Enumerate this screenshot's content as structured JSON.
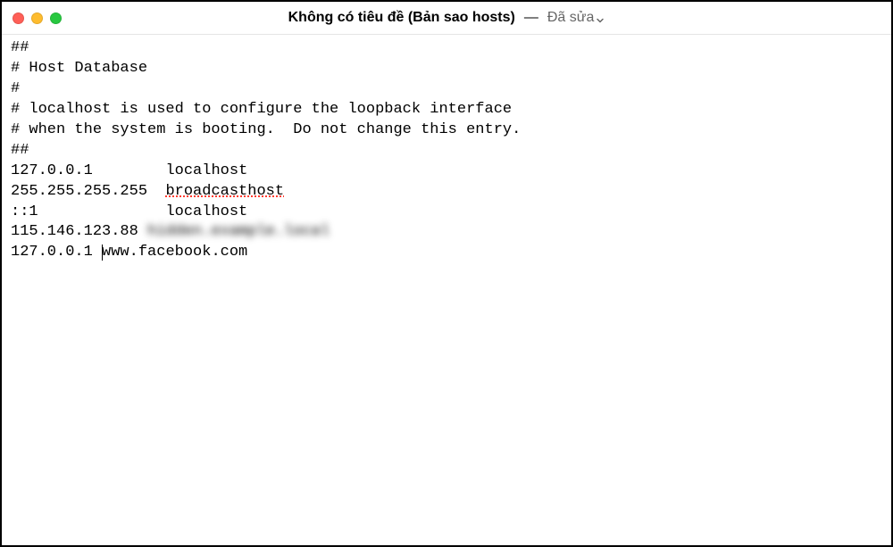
{
  "titlebar": {
    "title": "Không có tiêu đề (Bản sao hosts)",
    "separator": "—",
    "status": "Đã sửa"
  },
  "editor": {
    "lines": [
      "##",
      "# Host Database",
      "#",
      "# localhost is used to configure the loopback interface",
      "# when the system is booting.  Do not change this entry.",
      "##"
    ],
    "host_entries": {
      "loopback_ip": "127.0.0.1",
      "loopback_host": "localhost",
      "broadcast_ip": "255.255.255.255",
      "broadcast_host": "broadcasthost",
      "ipv6_ip": "::1",
      "ipv6_host": "localhost",
      "custom_ip": "115.146.123.88",
      "custom_host": "hidden.example.local",
      "new_ip": "127.0.0.1",
      "new_host": "www.facebook.com"
    }
  }
}
